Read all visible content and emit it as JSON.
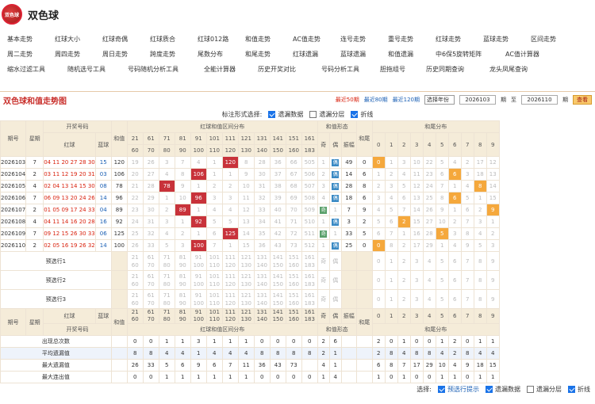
{
  "site": {
    "logo_text": "双色球",
    "title": "双色球"
  },
  "nav_rows": [
    [
      "基本走势",
      "红球大小",
      "红球奇偶",
      "红球质合",
      "红球012路",
      "和值走势",
      "AC值走势",
      "连号走势",
      "重号走势",
      "红球走势",
      "蓝球走势",
      "区间走势"
    ],
    [
      "周二走势",
      "周四走势",
      "周日走势",
      "跨度走势",
      "尾数分布",
      "和尾走势",
      "红球遗漏",
      "蓝球遗漏",
      "和值遗漏",
      "中6保5旋转矩阵",
      "AC值计算器"
    ],
    [
      "缩水过滤工具",
      "随机选号工具",
      "号码随机分析工具",
      "全能计算器",
      "历史开奖对比",
      "号码分析工具",
      "胆拖组号",
      "历史同期查询",
      "龙头凤尾查询"
    ]
  ],
  "section": {
    "title": "双色球和值走势图",
    "recent50": "最近50期",
    "recent80": "最近80期",
    "recent120": "最近120期",
    "select_label": "选择年份",
    "from": "2026103",
    "to": "2026110",
    "qi": "期",
    "zhi": "至",
    "query": "查看"
  },
  "options": {
    "label": "标注形式选择:",
    "opt1": "遗漏数据",
    "opt2": "遗漏分层",
    "opt3": "折线"
  },
  "headers": {
    "qihao": "期号",
    "xingqi": "星期",
    "kaijiang": "开奖号码",
    "hongqiu": "红球",
    "lanqiu": "蓝球",
    "hezhi": "和值",
    "qujian": "红球和值区间分布",
    "xingtai": "和值形态",
    "ji": "奇",
    "ou": "偶",
    "zhenfu": "振幅",
    "hewei": "和尾",
    "hewei_fb": "和尾分布"
  },
  "ranges": [
    [
      "21",
      "60"
    ],
    [
      "61",
      "70"
    ],
    [
      "71",
      "80"
    ],
    [
      "81",
      "90"
    ],
    [
      "91",
      "100"
    ],
    [
      "101",
      "110"
    ],
    [
      "111",
      "120"
    ],
    [
      "121",
      "130"
    ],
    [
      "131",
      "140"
    ],
    [
      "141",
      "150"
    ],
    [
      "151",
      "160"
    ],
    [
      "161",
      "183"
    ]
  ],
  "digits": [
    "0",
    "1",
    "2",
    "3",
    "4",
    "5",
    "6",
    "7",
    "8",
    "9"
  ],
  "rows": [
    {
      "qi": "2026103",
      "w": "7",
      "red": "04 11 20 27 28 30",
      "blue": "15",
      "sum": "120",
      "ranges": [
        "19",
        "26",
        "3",
        "7",
        "4",
        "1",
        "120",
        "8",
        "28",
        "36",
        "66",
        "505"
      ],
      "hit": 6,
      "ji": "1",
      "ou": "偶",
      "zf": "49",
      "wei": "0",
      "digits": [
        "0",
        "1",
        "3",
        "10",
        "22",
        "5",
        "4",
        "2",
        "17",
        "12"
      ],
      "hitd": 0,
      "shape": "ou"
    },
    {
      "qi": "2026104",
      "w": "2",
      "red": "03 11 12 19 20 31",
      "blue": "03",
      "sum": "106",
      "ranges": [
        "20",
        "27",
        "4",
        "8",
        "106",
        "1",
        "1",
        "9",
        "30",
        "37",
        "67",
        "506"
      ],
      "hit": 4,
      "ji": "2",
      "ou": "偶",
      "zf": "14",
      "wei": "6",
      "digits": [
        "1",
        "2",
        "4",
        "11",
        "23",
        "6",
        "6",
        "3",
        "18",
        "13"
      ],
      "hitd": 6,
      "shape": "ou"
    },
    {
      "qi": "2026105",
      "w": "4",
      "red": "02 04 13 14 15 30",
      "blue": "08",
      "sum": "78",
      "ranges": [
        "21",
        "28",
        "78",
        "9",
        "1",
        "2",
        "2",
        "10",
        "31",
        "38",
        "68",
        "507"
      ],
      "hit": 2,
      "ji": "3",
      "ou": "偶",
      "zf": "28",
      "wei": "8",
      "digits": [
        "2",
        "3",
        "5",
        "12",
        "24",
        "7",
        "1",
        "4",
        "8",
        "14"
      ],
      "hitd": 8,
      "shape": "ou"
    },
    {
      "qi": "2026106",
      "w": "7",
      "red": "06 09 13 20 24 26",
      "blue": "14",
      "sum": "96",
      "ranges": [
        "22",
        "29",
        "1",
        "10",
        "96",
        "3",
        "3",
        "11",
        "32",
        "39",
        "69",
        "508"
      ],
      "hit": 4,
      "ji": "4",
      "ou": "偶",
      "zf": "18",
      "wei": "6",
      "digits": [
        "3",
        "4",
        "6",
        "13",
        "25",
        "8",
        "6",
        "5",
        "1",
        "15"
      ],
      "hitd": 6,
      "shape": "ou"
    },
    {
      "qi": "2026107",
      "w": "2",
      "red": "01 05 09 17 24 33",
      "blue": "04",
      "sum": "89",
      "ranges": [
        "23",
        "30",
        "2",
        "89",
        "1",
        "4",
        "4",
        "12",
        "33",
        "40",
        "70",
        "509"
      ],
      "hit": 3,
      "ji": "奇",
      "ou": "1",
      "zf": "7",
      "wei": "9",
      "digits": [
        "4",
        "5",
        "7",
        "14",
        "26",
        "9",
        "1",
        "6",
        "2",
        "9"
      ],
      "hitd": 9,
      "shape": "ji"
    },
    {
      "qi": "2026108",
      "w": "4",
      "red": "04 11 14 16 20 28",
      "blue": "16",
      "sum": "92",
      "ranges": [
        "24",
        "31",
        "3",
        "1",
        "92",
        "5",
        "5",
        "13",
        "34",
        "41",
        "71",
        "510"
      ],
      "hit": 4,
      "ji": "1",
      "ou": "偶",
      "zf": "3",
      "wei": "2",
      "digits": [
        "5",
        "6",
        "2",
        "15",
        "27",
        "10",
        "2",
        "7",
        "3",
        "1"
      ],
      "hitd": 2,
      "shape": "ou"
    },
    {
      "qi": "2026109",
      "w": "7",
      "red": "09 12 15 26 30 33",
      "blue": "06",
      "sum": "125",
      "ranges": [
        "25",
        "32",
        "4",
        "2",
        "1",
        "6",
        "125",
        "14",
        "35",
        "42",
        "72",
        "511"
      ],
      "hit": 6,
      "ji": "奇",
      "ou": "1",
      "zf": "33",
      "wei": "5",
      "digits": [
        "6",
        "7",
        "1",
        "16",
        "28",
        "5",
        "3",
        "8",
        "4",
        "2"
      ],
      "hitd": 5,
      "shape": "ji"
    },
    {
      "qi": "2026110",
      "w": "2",
      "red": "02 05 16 19 26 32",
      "blue": "14",
      "sum": "100",
      "ranges": [
        "26",
        "33",
        "5",
        "3",
        "100",
        "7",
        "1",
        "15",
        "36",
        "43",
        "73",
        "512"
      ],
      "hit": 4,
      "ji": "1",
      "ou": "偶",
      "zf": "25",
      "wei": "0",
      "digits": [
        "0",
        "8",
        "2",
        "17",
        "29",
        "1",
        "4",
        "9",
        "5",
        "3"
      ],
      "hitd": 0,
      "shape": "ou"
    }
  ],
  "preselect": [
    "预选行1",
    "预选行2",
    "预选行3"
  ],
  "stats_labels": [
    "出现总次数",
    "平均遗漏值",
    "最大遗漏值",
    "最大连出值"
  ],
  "stats": [
    {
      "ranges": [
        "0",
        "0",
        "1",
        "1",
        "3",
        "1",
        "1",
        "1",
        "0",
        "0",
        "0",
        "0"
      ],
      "ji": "2",
      "ou": "6",
      "wei": [
        "2",
        "0",
        "1",
        "0",
        "0",
        "1",
        "2",
        "0",
        "1",
        "1"
      ]
    },
    {
      "ranges": [
        "8",
        "8",
        "4",
        "4",
        "1",
        "4",
        "4",
        "4",
        "8",
        "8",
        "8",
        "8"
      ],
      "ji": "2",
      "ou": "1",
      "wei": [
        "2",
        "8",
        "4",
        "8",
        "8",
        "4",
        "2",
        "8",
        "4",
        "4"
      ]
    },
    {
      "ranges": [
        "26",
        "33",
        "5",
        "6",
        "9",
        "6",
        "7",
        "11",
        "36",
        "43",
        "73",
        ""
      ],
      "ji": "4",
      "ou": "1",
      "wei": [
        "6",
        "8",
        "7",
        "17",
        "29",
        "10",
        "4",
        "9",
        "18",
        "15"
      ]
    },
    {
      "ranges": [
        "0",
        "0",
        "1",
        "1",
        "1",
        "1",
        "1",
        "1",
        "0",
        "0",
        "0",
        "0"
      ],
      "ji": "1",
      "ou": "4",
      "wei": [
        "1",
        "0",
        "1",
        "0",
        "0",
        "1",
        "1",
        "0",
        "1",
        "1"
      ]
    }
  ],
  "footer": {
    "label": "选择:",
    "o1": "预选行提示",
    "o2": "遗漏数据",
    "o3": "遗漏分层",
    "o4": "折线"
  }
}
